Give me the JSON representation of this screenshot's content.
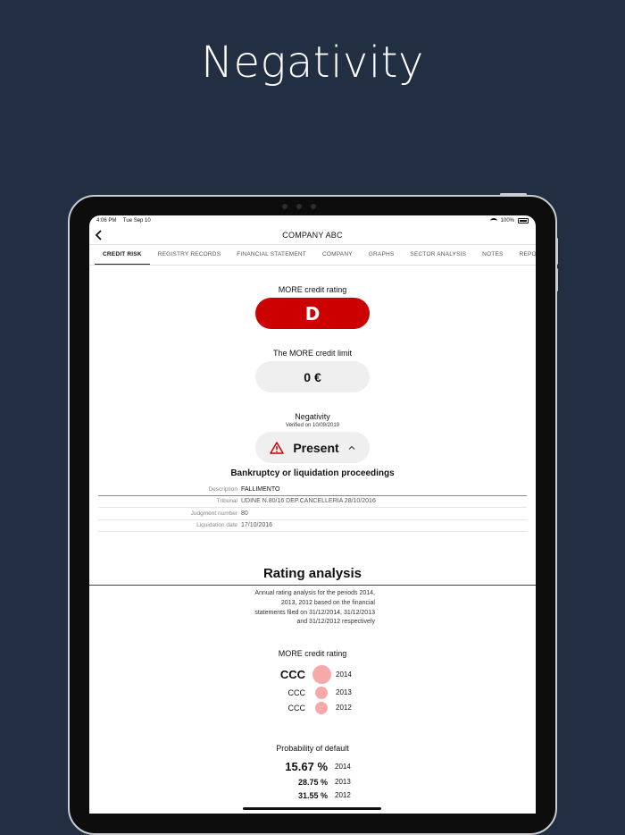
{
  "headline": "Negativity",
  "status": {
    "time": "4:06 PM",
    "date": "Tue Sep 10",
    "battery": "100%"
  },
  "nav": {
    "title": "COMPANY ABC"
  },
  "tabs": [
    {
      "label": "CREDIT RISK",
      "active": true
    },
    {
      "label": "REGISTRY RECORDS"
    },
    {
      "label": "FINANCIAL STATEMENT"
    },
    {
      "label": "COMPANY"
    },
    {
      "label": "GRAPHS"
    },
    {
      "label": "SECTOR ANALYSIS"
    },
    {
      "label": "NOTES"
    },
    {
      "label": "REPOR"
    }
  ],
  "credit_rating": {
    "label": "MORE credit rating",
    "value": "D",
    "color": "#cc0000"
  },
  "credit_limit": {
    "label": "The MORE credit limit",
    "value": "0 €"
  },
  "negativity": {
    "label": "Negativity",
    "verified": "Verified on 10/09/2019",
    "value": "Present"
  },
  "proceedings": {
    "heading": "Bankruptcy or liquidation proceedings",
    "rows": [
      {
        "label": "Description",
        "value": "FALLIMENTO"
      },
      {
        "label": "Tribunal",
        "value": "UDINE N.80/16 DEP.CANCELLERIA 28/10/2016"
      },
      {
        "label": "Judgment number",
        "value": "80"
      },
      {
        "label": "Liquidation date",
        "value": "17/10/2016"
      }
    ]
  },
  "rating_analysis": {
    "title": "Rating analysis",
    "description": "Annual rating analysis for the periods 2014, 2013, 2012 based on the financial statements filed on 31/12/2014, 31/12/2013 and 31/12/2012 respectively",
    "credit_rating_label": "MORE credit rating",
    "ratings": [
      {
        "value": "CCC",
        "year": "2014"
      },
      {
        "value": "CCC",
        "year": "2013"
      },
      {
        "value": "CCC",
        "year": "2012"
      }
    ],
    "pd_label": "Probability of default",
    "pd": [
      {
        "value": "15.67 %",
        "year": "2014"
      },
      {
        "value": "28.75 %",
        "year": "2013"
      },
      {
        "value": "31.55 %",
        "year": "2012"
      }
    ]
  }
}
